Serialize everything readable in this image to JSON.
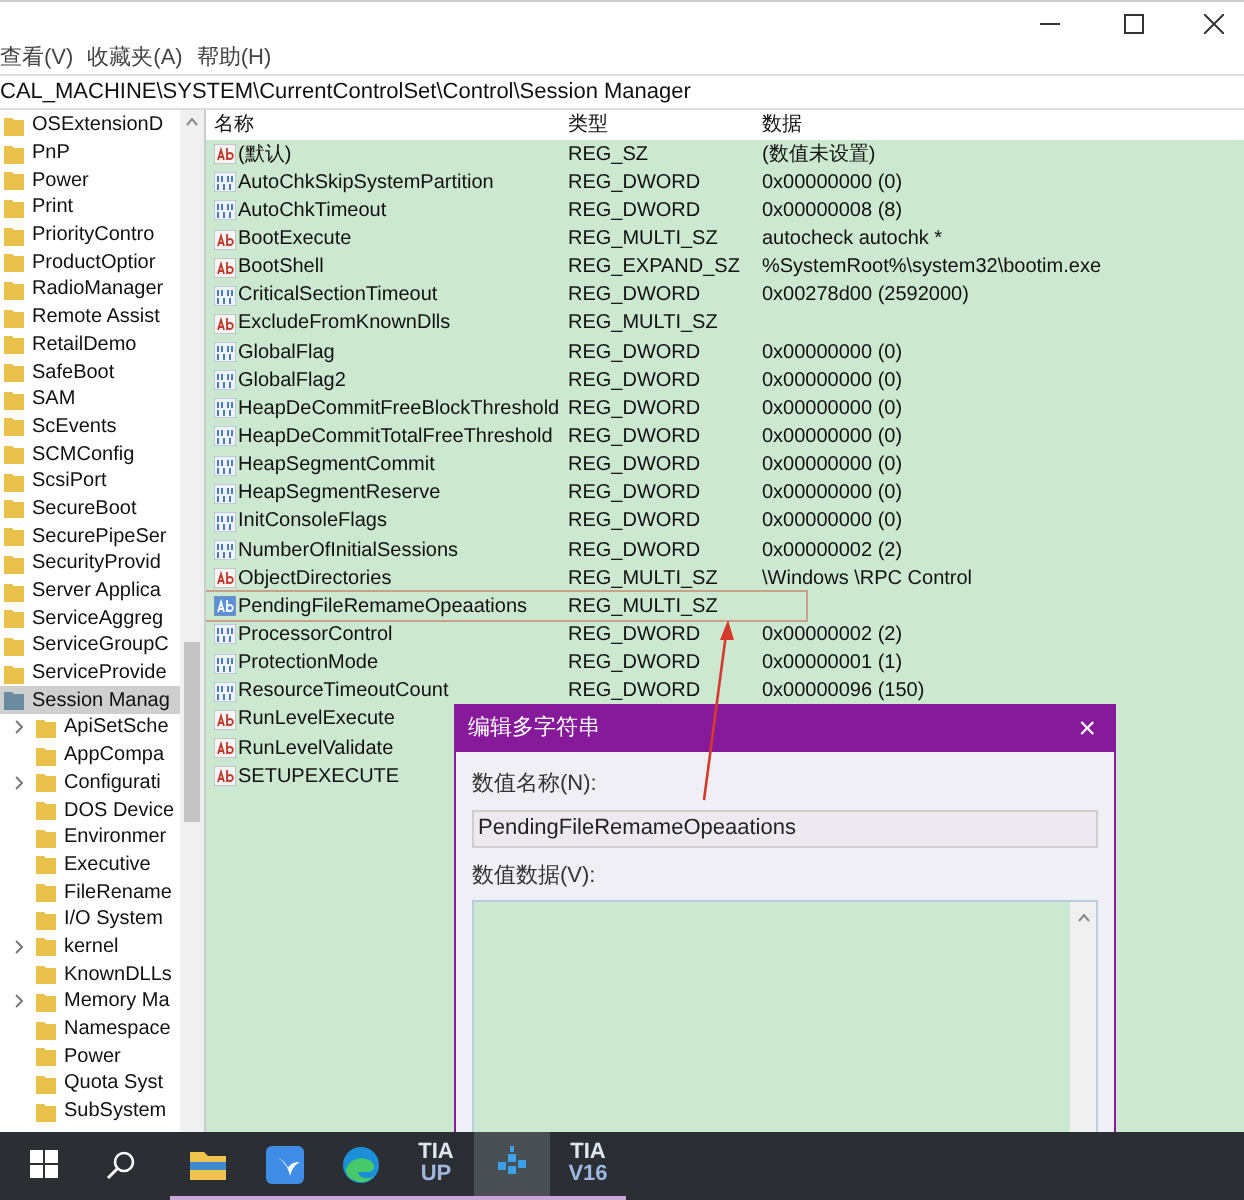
{
  "menu": [
    "查看(V)",
    "收藏夹(A)",
    "帮助(H)"
  ],
  "address": "CAL_MACHINE\\SYSTEM\\CurrentControlSet\\Control\\Session Manager",
  "tree": {
    "items": [
      {
        "label": "OSExtensionD",
        "selected": false
      },
      {
        "label": "PnP",
        "selected": false
      },
      {
        "label": "Power",
        "selected": false
      },
      {
        "label": "Print",
        "selected": false
      },
      {
        "label": "PriorityContro",
        "selected": false
      },
      {
        "label": "ProductOptior",
        "selected": false
      },
      {
        "label": "RadioManager",
        "selected": false
      },
      {
        "label": "Remote Assist",
        "selected": false
      },
      {
        "label": "RetailDemo",
        "selected": false
      },
      {
        "label": "SafeBoot",
        "selected": false
      },
      {
        "label": "SAM",
        "selected": false
      },
      {
        "label": "ScEvents",
        "selected": false
      },
      {
        "label": "SCMConfig",
        "selected": false
      },
      {
        "label": "ScsiPort",
        "selected": false
      },
      {
        "label": "SecureBoot",
        "selected": false
      },
      {
        "label": "SecurePipeSer",
        "selected": false
      },
      {
        "label": "SecurityProvid",
        "selected": false
      },
      {
        "label": "Server Applica",
        "selected": false
      },
      {
        "label": "ServiceAggreg",
        "selected": false
      },
      {
        "label": "ServiceGroupC",
        "selected": false
      },
      {
        "label": "ServiceProvide",
        "selected": false
      },
      {
        "label": "Session Manag",
        "selected": true,
        "children": [
          {
            "label": "ApiSetSche",
            "selected": false,
            "expandable": true
          },
          {
            "label": "AppCompa",
            "selected": false,
            "expandable": false
          },
          {
            "label": "Configurati",
            "selected": false,
            "expandable": true
          },
          {
            "label": "DOS Device",
            "selected": false,
            "expandable": false
          },
          {
            "label": "Environmer",
            "selected": false,
            "expandable": false
          },
          {
            "label": "Executive",
            "selected": false,
            "expandable": false
          },
          {
            "label": "FileRename",
            "selected": false,
            "expandable": false
          },
          {
            "label": "I/O System",
            "selected": false,
            "expandable": false
          },
          {
            "label": "kernel",
            "selected": false,
            "expandable": true
          },
          {
            "label": "KnownDLLs",
            "selected": false,
            "expandable": false
          },
          {
            "label": "Memory Ma",
            "selected": false,
            "expandable": true
          },
          {
            "label": "Namespace",
            "selected": false,
            "expandable": false
          },
          {
            "label": "Power",
            "selected": false,
            "expandable": false
          },
          {
            "label": "Quota Syst",
            "selected": false,
            "expandable": false
          },
          {
            "label": "SubSystem",
            "selected": false,
            "expandable": false
          }
        ]
      }
    ]
  },
  "table": {
    "columns": [
      "名称",
      "类型",
      "数据"
    ],
    "rows": [
      {
        "kind": "string",
        "name": "(默认)",
        "type": "REG_SZ",
        "data": "(数值未设置)",
        "selected": false
      },
      {
        "kind": "binary",
        "name": "AutoChkSkipSystemPartition",
        "type": "REG_DWORD",
        "data": "0x00000000 (0)",
        "selected": false
      },
      {
        "kind": "binary",
        "name": "AutoChkTimeout",
        "type": "REG_DWORD",
        "data": "0x00000008 (8)",
        "selected": false
      },
      {
        "kind": "string",
        "name": "BootExecute",
        "type": "REG_MULTI_SZ",
        "data": "autocheck autochk *",
        "selected": false
      },
      {
        "kind": "string",
        "name": "BootShell",
        "type": "REG_EXPAND_SZ",
        "data": "%SystemRoot%\\system32\\bootim.exe",
        "selected": false
      },
      {
        "kind": "binary",
        "name": "CriticalSectionTimeout",
        "type": "REG_DWORD",
        "data": "0x00278d00 (2592000)",
        "selected": false
      },
      {
        "kind": "string",
        "name": "ExcludeFromKnownDlls",
        "type": "REG_MULTI_SZ",
        "selected": false
      },
      {
        "kind": "binary",
        "name": "GlobalFlag",
        "type": "REG_DWORD",
        "data": "0x00000000 (0)",
        "selected": false
      },
      {
        "kind": "binary",
        "name": "GlobalFlag2",
        "type": "REG_DWORD",
        "data": "0x00000000 (0)",
        "selected": false
      },
      {
        "kind": "binary",
        "name": "HeapDeCommitFreeBlockThreshold",
        "type": "REG_DWORD",
        "data": "0x00000000 (0)",
        "selected": false
      },
      {
        "kind": "binary",
        "name": "HeapDeCommitTotalFreeThreshold",
        "type": "REG_DWORD",
        "data": "0x00000000 (0)",
        "selected": false
      },
      {
        "kind": "binary",
        "name": "HeapSegmentCommit",
        "type": "REG_DWORD",
        "data": "0x00000000 (0)",
        "selected": false
      },
      {
        "kind": "binary",
        "name": "HeapSegmentReserve",
        "type": "REG_DWORD",
        "data": "0x00000000 (0)",
        "selected": false
      },
      {
        "kind": "binary",
        "name": "InitConsoleFlags",
        "type": "REG_DWORD",
        "data": "0x00000000 (0)",
        "selected": false
      },
      {
        "kind": "binary",
        "name": "NumberOfInitialSessions",
        "type": "REG_DWORD",
        "data": "0x00000002 (2)",
        "selected": false
      },
      {
        "kind": "string",
        "name": "ObjectDirectories",
        "type": "REG_MULTI_SZ",
        "data": "\\Windows \\RPC Control",
        "selected": false
      },
      {
        "kind": "string",
        "name": "PendingFileRemameOpeaations",
        "type": "REG_MULTI_SZ",
        "selected": true
      },
      {
        "kind": "binary",
        "name": "ProcessorControl",
        "type": "REG_DWORD",
        "data": "0x00000002 (2)",
        "selected": false
      },
      {
        "kind": "binary",
        "name": "ProtectionMode",
        "type": "REG_DWORD",
        "data": "0x00000001 (1)",
        "selected": false
      },
      {
        "kind": "binary",
        "name": "ResourceTimeoutCount",
        "type": "REG_DWORD",
        "data": "0x00000096 (150)",
        "selected": false
      },
      {
        "kind": "string",
        "name": "RunLevelExecute",
        "selected": false
      },
      {
        "kind": "string",
        "name": "RunLevelValidate",
        "selected": false
      },
      {
        "kind": "string",
        "name": "SETUPEXECUTE",
        "selected": false
      }
    ]
  },
  "dialog": {
    "title": "编辑多字符串",
    "close": "×",
    "name_label": "数值名称(N):",
    "name_value": "PendingFileRemameOpeaations",
    "data_label": "数值数据(V):"
  },
  "taskbar": {
    "items": [
      {
        "kind": "start",
        "selected": false,
        "running": false
      },
      {
        "kind": "search",
        "selected": false,
        "running": false
      },
      {
        "kind": "folder",
        "selected": false,
        "running": true
      },
      {
        "kind": "bird",
        "selected": false,
        "running": true
      },
      {
        "kind": "browser",
        "selected": false,
        "running": true
      },
      {
        "kind": "tia",
        "line1": "TIA",
        "line2": "UP",
        "selected": false,
        "running": true
      },
      {
        "kind": "cubes",
        "selected": true,
        "running": true
      },
      {
        "kind": "tia",
        "line1": "TIA",
        "line2": "V16",
        "selected": false,
        "running": true
      }
    ]
  }
}
